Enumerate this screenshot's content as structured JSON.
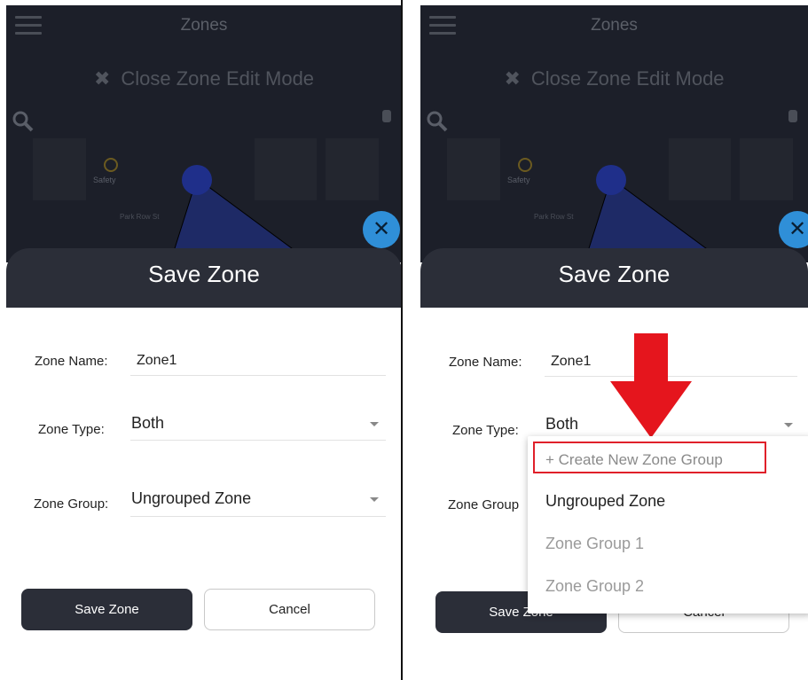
{
  "map": {
    "title": "Zones",
    "close_edit_label": "Close Zone Edit Mode",
    "close_edit_icon": "close-icon",
    "poi_label": "Safety",
    "street_label": "Park Row St",
    "fab_symbol": "✕"
  },
  "left": {
    "sheet_title": "Save Zone",
    "zone_name_label": "Zone Name:",
    "zone_name_value": "Zone1",
    "zone_type_label": "Zone Type:",
    "zone_type_value": "Both",
    "zone_group_label": "Zone Group:",
    "zone_group_value": "Ungrouped Zone",
    "save_button": "Save Zone",
    "cancel_button": "Cancel"
  },
  "right": {
    "sheet_title": "Save Zone",
    "zone_name_label": "Zone Name:",
    "zone_name_value": "Zone1",
    "zone_type_label": "Zone Type:",
    "zone_type_value": "Both",
    "zone_group_label": "Zone Group",
    "save_button": "Save Zone",
    "cancel_button": "Cancel",
    "dropdown_options": [
      "+ Create New Zone Group",
      "Ungrouped Zone",
      "Zone Group 1",
      "Zone Group 2"
    ]
  },
  "colors": {
    "map_bg": "#1c1f29",
    "sheet_header": "#2b2e38",
    "fab": "#2f8fd8",
    "highlight": "#e0202a"
  }
}
